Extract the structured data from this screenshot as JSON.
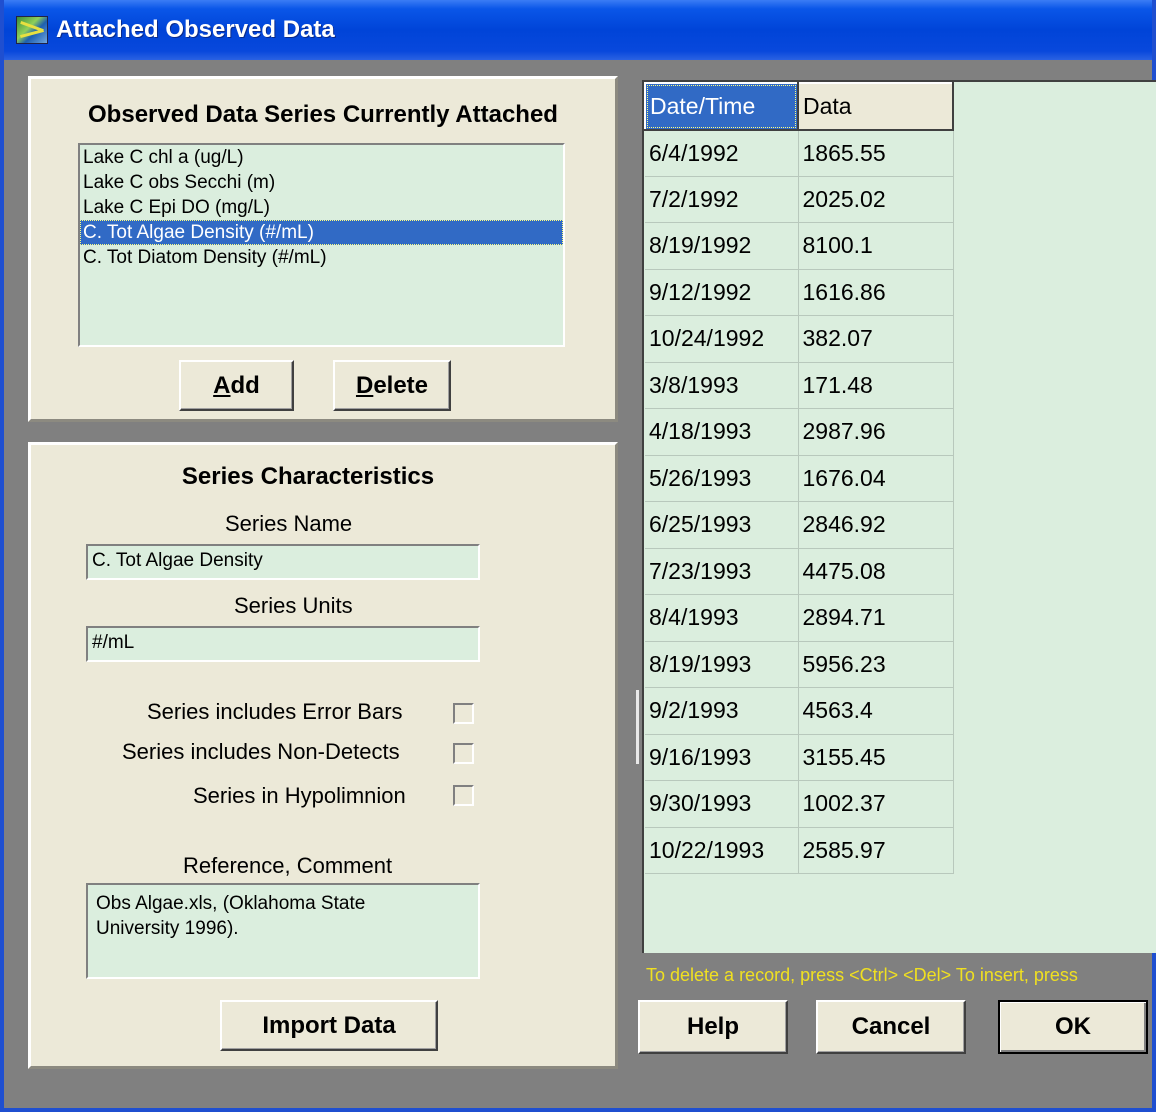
{
  "window": {
    "title": "Attached Observed Data",
    "icon": "app-chart-icon"
  },
  "attached_panel": {
    "heading": "Observed Data Series Currently Attached",
    "series_list": [
      "Lake C chl a (ug/L)",
      "Lake C obs Secchi (m)",
      "Lake C Epi DO (mg/L)",
      "C. Tot Algae Density (#/mL)",
      "C. Tot Diatom Density (#/mL)"
    ],
    "selected_index": 3,
    "add_button": {
      "accel": "A",
      "rest": "dd"
    },
    "delete_button": {
      "accel": "D",
      "rest": "elete"
    }
  },
  "characteristics_panel": {
    "heading": "Series Characteristics",
    "series_name_label": "Series Name",
    "series_name_value": "C. Tot Algae Density",
    "series_units_label": "Series Units",
    "series_units_value": "#/mL",
    "checkboxes": [
      {
        "label": "Series includes Error Bars",
        "checked": false
      },
      {
        "label": "Series includes Non-Detects",
        "checked": false
      },
      {
        "label": "Series in Hypolimnion",
        "checked": false
      }
    ],
    "reference_label": "Reference, Comment",
    "reference_value": "Obs Algae.xls, (Oklahoma State\nUniversity 1996).",
    "import_button": "Import Data"
  },
  "grid": {
    "headers": [
      "Date/Time",
      "Data"
    ],
    "selected_header": 0,
    "rows": [
      [
        "6/4/1992",
        "1865.55"
      ],
      [
        "7/2/1992",
        "2025.02"
      ],
      [
        "8/19/1992",
        "8100.1"
      ],
      [
        "9/12/1992",
        "1616.86"
      ],
      [
        "10/24/1992",
        "382.07"
      ],
      [
        "3/8/1993",
        "171.48"
      ],
      [
        "4/18/1993",
        "2987.96"
      ],
      [
        "5/26/1993",
        "1676.04"
      ],
      [
        "6/25/1993",
        "2846.92"
      ],
      [
        "7/23/1993",
        "4475.08"
      ],
      [
        "8/4/1993",
        "2894.71"
      ],
      [
        "8/19/1993",
        "5956.23"
      ],
      [
        "9/2/1993",
        "4563.4"
      ],
      [
        "9/16/1993",
        "3155.45"
      ],
      [
        "9/30/1993",
        "1002.37"
      ],
      [
        "10/22/1993",
        "2585.97"
      ]
    ]
  },
  "hint": "To delete a record, press <Ctrl> <Del>   To insert, press",
  "footer_buttons": {
    "help": "Help",
    "cancel": "Cancel",
    "ok": "OK"
  },
  "colors": {
    "titlebar": "#0044d8",
    "panel": "#ece9d8",
    "field": "#dbeede",
    "selection": "#316ac5",
    "hint": "#f0e020"
  }
}
